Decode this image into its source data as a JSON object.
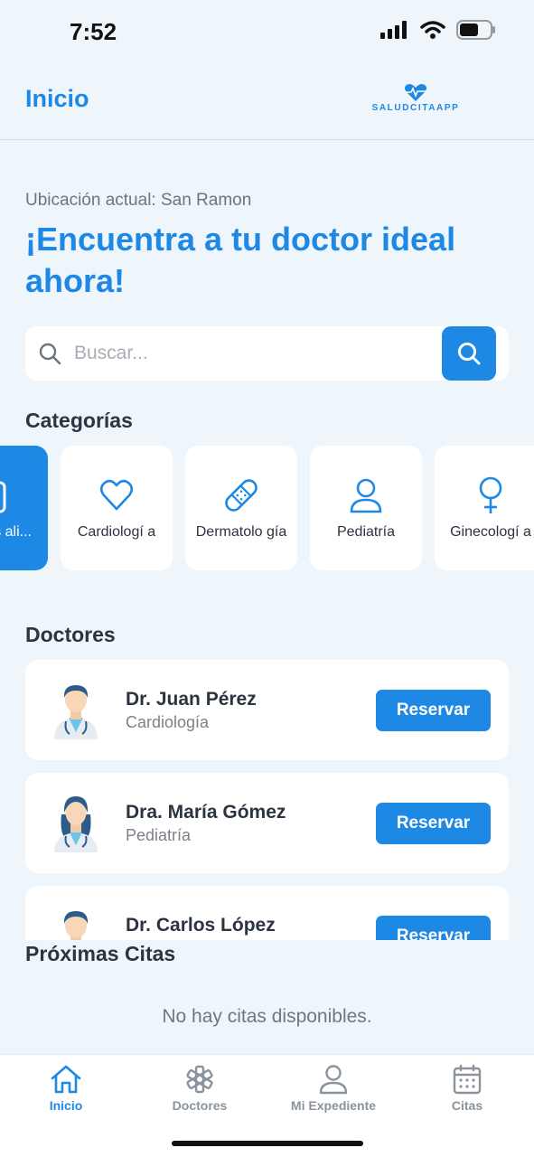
{
  "status": {
    "time": "7:52"
  },
  "header": {
    "title": "Inicio",
    "brand": "SALUDCITAAPP"
  },
  "location": "Ubicación actual: San Ramon",
  "headline": "¡Encuentra a tu doctor ideal ahora!",
  "search": {
    "placeholder": "Buscar..."
  },
  "categories": {
    "title": "Categorías",
    "items": [
      {
        "label": "Todas las especiali...",
        "visible": "las ali...",
        "icon": "clipboard-icon",
        "active": true
      },
      {
        "label": "Cardiología",
        "visible": "Cardiologí a",
        "icon": "heart-icon"
      },
      {
        "label": "Dermatología",
        "visible": "Dermatolo gía",
        "icon": "bandage-icon"
      },
      {
        "label": "Pediatría",
        "visible": "Pediatría",
        "icon": "person-icon"
      },
      {
        "label": "Ginecología",
        "visible": "Ginecologí a",
        "icon": "female-icon"
      }
    ]
  },
  "doctors": {
    "title": "Doctores",
    "reserve_label": "Reservar",
    "items": [
      {
        "name": "Dr. Juan Pérez",
        "specialty": "Cardiología",
        "avatar": "male-doctor-icon"
      },
      {
        "name": "Dra. María Gómez",
        "specialty": "Pediatría",
        "avatar": "female-doctor-icon"
      },
      {
        "name": "Dr. Carlos López",
        "specialty": "",
        "avatar": "male-doctor-icon"
      }
    ]
  },
  "appointments": {
    "title": "Próximas Citas",
    "empty": "No hay citas disponibles."
  },
  "tabs": [
    {
      "label": "Inicio",
      "icon": "home-icon",
      "active": true
    },
    {
      "label": "Doctores",
      "icon": "medical-asterisk-icon"
    },
    {
      "label": "Mi Expediente",
      "icon": "person-icon"
    },
    {
      "label": "Citas",
      "icon": "calendar-icon"
    }
  ],
  "colors": {
    "accent": "#1e88e5",
    "background": "#eef5fb"
  }
}
